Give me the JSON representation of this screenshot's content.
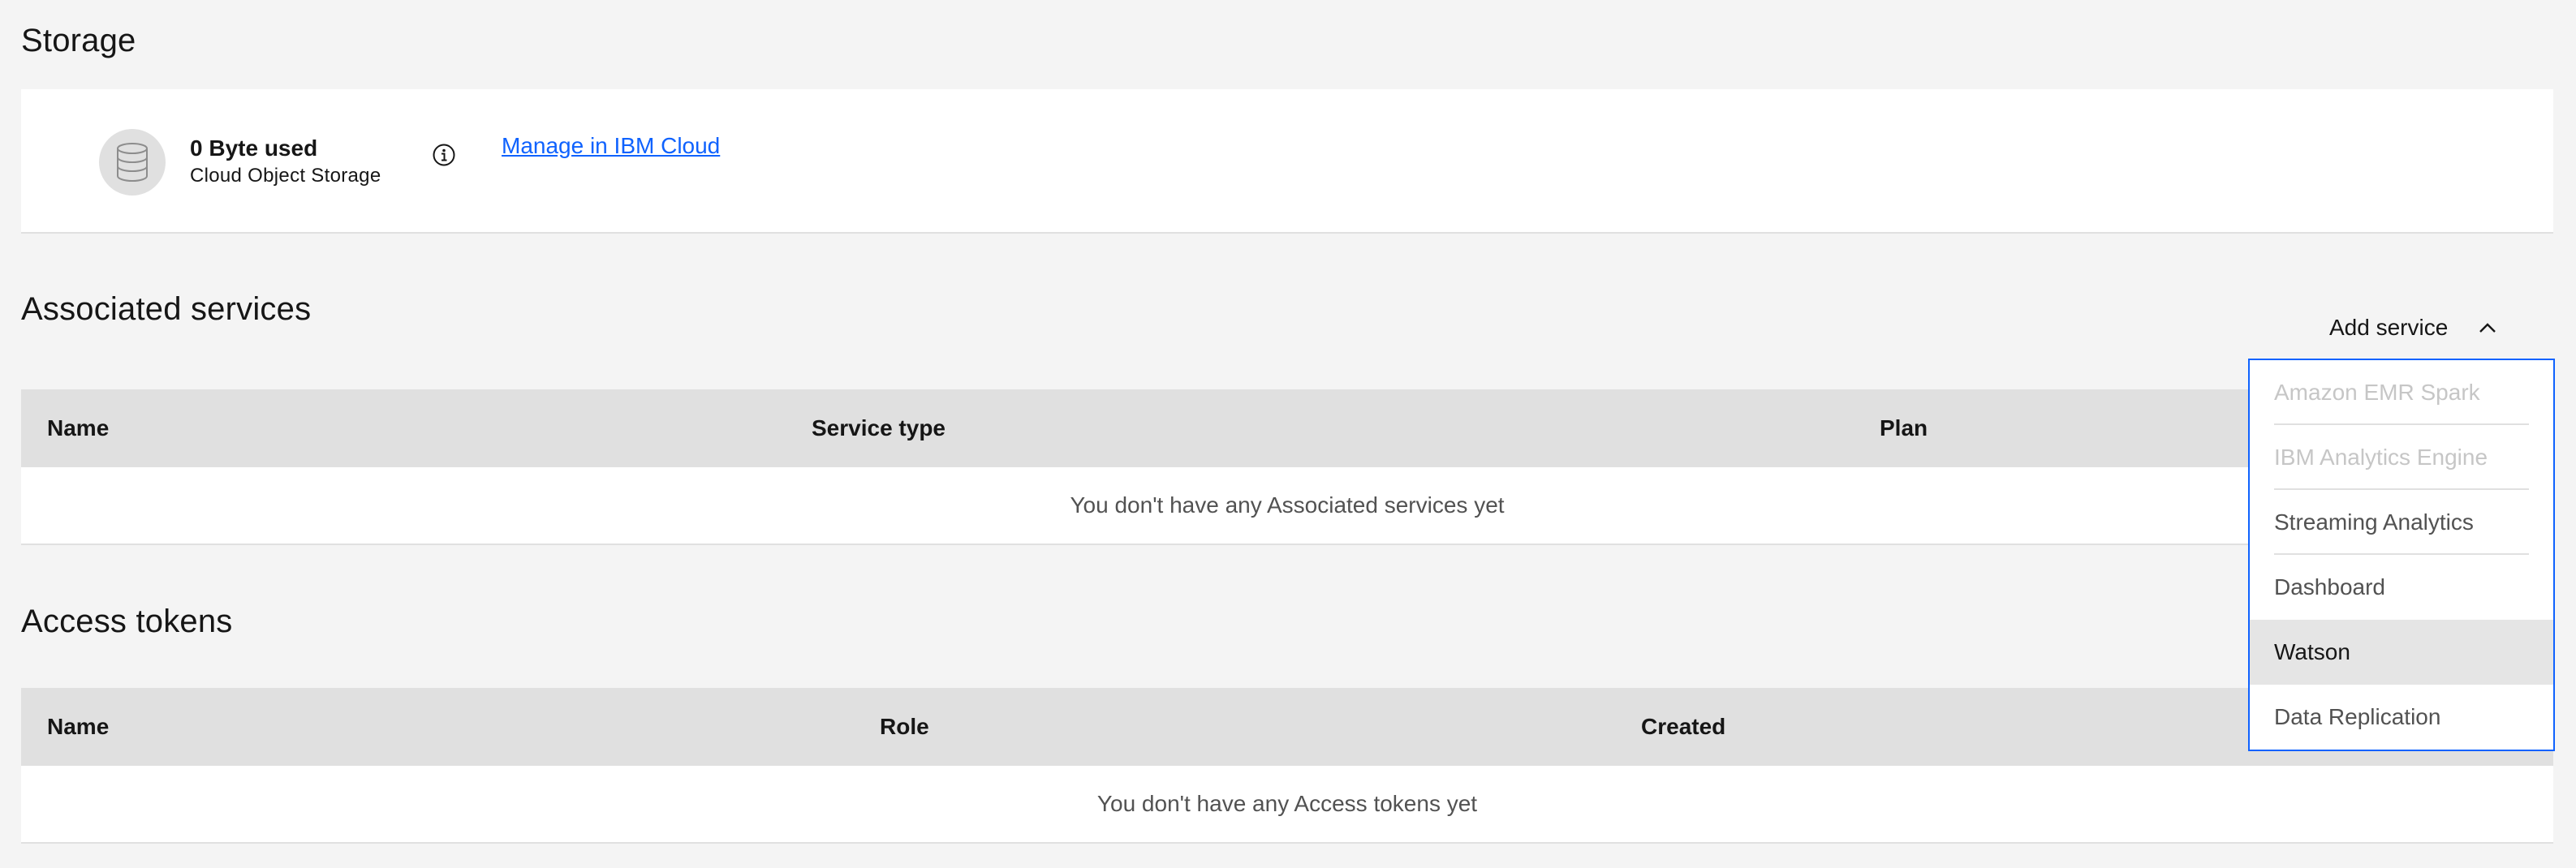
{
  "storage": {
    "title": "Storage",
    "used": "0 Byte used",
    "service": "Cloud Object Storage",
    "icon": "database-icon",
    "info_icon": "info-icon",
    "manage_link": "Manage in IBM Cloud"
  },
  "associated_services": {
    "title": "Associated services",
    "add_service_label": "Add service",
    "columns": [
      "Name",
      "Service type",
      "Plan"
    ],
    "empty_message": "You don't have any Associated services yet",
    "dropdown": {
      "items": [
        {
          "label": "Amazon EMR Spark",
          "state": "disabled"
        },
        {
          "label": "IBM Analytics Engine",
          "state": "disabled"
        },
        {
          "label": "Streaming Analytics",
          "state": "enabled"
        },
        {
          "label": "Dashboard",
          "state": "enabled"
        },
        {
          "label": "Watson",
          "state": "highlighted"
        },
        {
          "label": "Data Replication",
          "state": "enabled"
        }
      ]
    }
  },
  "access_tokens": {
    "title": "Access tokens",
    "columns": [
      "Name",
      "Role",
      "Created"
    ],
    "empty_message": "You don't have any Access tokens yet"
  },
  "colors": {
    "background": "#f4f4f4",
    "card": "#ffffff",
    "header_row": "#e0e0e0",
    "link": "#0f62fe",
    "dropdown_border": "#0f62fe",
    "disabled_text": "#c6c6c6",
    "highlight": "#e5e5e5"
  }
}
